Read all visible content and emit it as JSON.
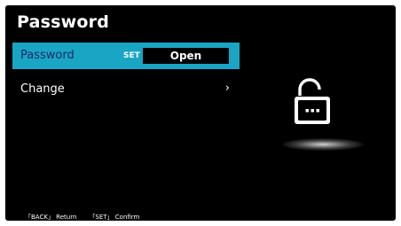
{
  "screen": {
    "title": "Password"
  },
  "menu": {
    "items": [
      {
        "label": "Password",
        "set_tag": "SET",
        "value": "Open"
      },
      {
        "label": "Change",
        "chevron": "›"
      }
    ]
  },
  "lock": {
    "icon": "unlocked-padlock-icon",
    "state": "unlocked"
  },
  "footer": {
    "back_hint": "「BACK」 Return",
    "set_hint": "「SET」 Confirm"
  },
  "colors": {
    "highlight": "#1aa5c4",
    "highlight_text": "#1a2b6a",
    "background": "#000000"
  }
}
